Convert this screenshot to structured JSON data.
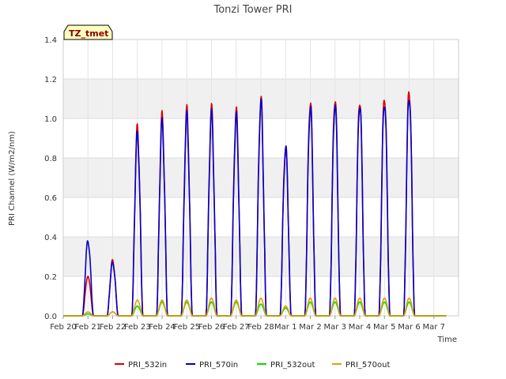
{
  "chart_data": {
    "type": "line",
    "title": "Tonzi Tower PRI",
    "xlabel": "Time",
    "ylabel": "PRI Channel (W/m2/nm)",
    "tag": "TZ_tmet",
    "ylim": [
      0,
      1.4
    ],
    "yticks": [
      "0.0",
      "0.2",
      "0.4",
      "0.6",
      "0.8",
      "1.0",
      "1.2",
      "1.4"
    ],
    "xlim": [
      0,
      16
    ],
    "xticks": [
      "Feb 20",
      "Feb 21",
      "Feb 22",
      "Feb 23",
      "Feb 24",
      "Feb 25",
      "Feb 26",
      "Feb 27",
      "Feb 28",
      "Mar 1",
      "Mar 2",
      "Mar 3",
      "Mar 4",
      "Mar 5",
      "Mar 6",
      "Mar 7"
    ],
    "grid": "horizontal bands",
    "legend_position": "bottom",
    "series": [
      {
        "name": "PRI_532in",
        "color": "#dd0000",
        "daily_peaks": [
          0.2,
          0.28,
          0.95,
          1.01,
          1.04,
          1.05,
          1.04,
          1.1,
          0.86,
          1.09,
          1.11,
          1.1,
          1.12,
          1.15
        ]
      },
      {
        "name": "PRI_570in",
        "color": "#0000cc",
        "daily_peaks": [
          0.38,
          0.27,
          0.92,
          0.98,
          1.01,
          1.02,
          1.01,
          1.08,
          0.85,
          1.06,
          1.08,
          1.08,
          1.09,
          1.12
        ]
      },
      {
        "name": "PRI_532out",
        "color": "#00dd00",
        "daily_peaks": [
          0.01,
          0.02,
          0.05,
          0.07,
          0.07,
          0.07,
          0.07,
          0.06,
          0.04,
          0.07,
          0.07,
          0.07,
          0.07,
          0.07
        ]
      },
      {
        "name": "PRI_570out",
        "color": "#e6a000",
        "daily_peaks": [
          0.02,
          0.02,
          0.08,
          0.08,
          0.08,
          0.09,
          0.08,
          0.09,
          0.05,
          0.09,
          0.09,
          0.09,
          0.09,
          0.09
        ]
      }
    ]
  }
}
